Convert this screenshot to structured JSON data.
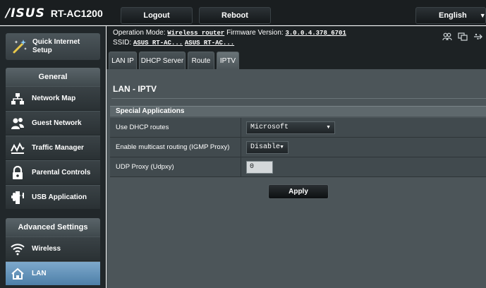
{
  "brand": {
    "logo": "/ISUS",
    "model": "RT-AC1200"
  },
  "topbar": {
    "logout_label": "Logout",
    "reboot_label": "Reboot",
    "language": "English"
  },
  "sidebar": {
    "quick_setup_label": "Quick Internet\nSetup",
    "general_heading": "General",
    "general_items": [
      {
        "label": "Network Map",
        "icon": "network-map-icon"
      },
      {
        "label": "Guest Network",
        "icon": "guest-network-icon"
      },
      {
        "label": "Traffic Manager",
        "icon": "traffic-manager-icon"
      },
      {
        "label": "Parental Controls",
        "icon": "parental-controls-icon"
      },
      {
        "label": "USB Application",
        "icon": "usb-application-icon"
      }
    ],
    "advanced_heading": "Advanced Settings",
    "advanced_items": [
      {
        "label": "Wireless",
        "icon": "wireless-icon"
      },
      {
        "label": "LAN",
        "icon": "lan-icon",
        "active": true
      }
    ]
  },
  "status": {
    "operation_mode_label": "Operation Mode:",
    "operation_mode_value": "Wireless router",
    "firmware_label": "Firmware Version:",
    "firmware_value": "3.0.0.4.378_6701",
    "ssid_label": "SSID:",
    "ssid_1": "ASUS RT-AC...",
    "ssid_2": "ASUS RT-AC..."
  },
  "tabs": [
    "LAN IP",
    "DHCP Server",
    "Route",
    "IPTV"
  ],
  "active_tab": "IPTV",
  "page": {
    "title": "LAN - IPTV",
    "section": "Special Applications",
    "fields": [
      {
        "label": "Use DHCP routes",
        "value": "Microsoft"
      },
      {
        "label": "Enable multicast routing (IGMP Proxy)",
        "value": "Disable"
      },
      {
        "label": "UDP Proxy (Udpxy)",
        "value": "0"
      }
    ],
    "apply_label": "Apply"
  },
  "colors": {
    "active_nav": "#5d8fb8",
    "panel_bg": "#4c5559",
    "topbar_bg": "#1a1e20"
  }
}
